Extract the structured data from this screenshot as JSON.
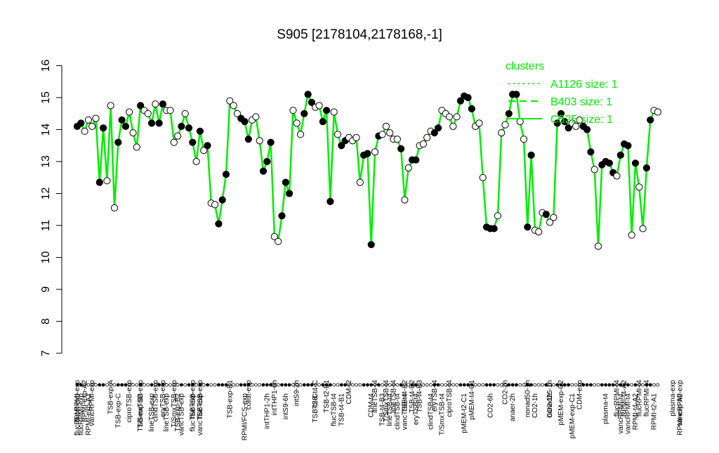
{
  "chart_data": {
    "type": "line",
    "title": "S905 [2178104,2178168,-1]",
    "xlabel": "",
    "ylabel": "",
    "ylim": [
      7,
      16
    ],
    "yticks": [
      7,
      8,
      9,
      10,
      11,
      12,
      13,
      14,
      15,
      16
    ],
    "grid": false,
    "series_color": "#00ee00",
    "y": [
      14.1,
      14.2,
      13.95,
      14.3,
      14.1,
      14.35,
      12.35,
      14.05,
      12.4,
      14.75,
      11.55,
      13.6,
      14.3,
      14.1,
      14.55,
      13.9,
      13.45,
      14.75,
      14.6,
      14.5,
      14.2,
      14.8,
      14.2,
      14.8,
      14.6,
      14.6,
      13.6,
      13.8,
      14.1,
      14.5,
      14.05,
      13.6,
      13.0,
      13.95,
      13.35,
      13.5,
      11.7,
      11.65,
      11.05,
      11.8,
      12.6,
      14.9,
      14.75,
      14.5,
      14.35,
      14.25,
      13.7,
      14.3,
      14.4,
      13.65,
      12.7,
      13.0,
      13.6,
      10.65,
      10.5,
      11.3,
      12.35,
      12.0,
      14.6,
      14.2,
      13.85,
      14.5,
      15.1,
      14.85,
      14.7,
      14.75,
      14.25,
      14.6,
      11.75,
      14.55,
      13.85,
      13.5,
      13.65,
      13.75,
      13.65,
      13.75,
      12.35,
      13.2,
      13.25,
      10.4,
      13.3,
      13.8,
      13.85,
      14.1,
      13.9,
      13.7,
      13.7,
      13.4,
      11.8,
      12.8,
      13.05,
      13.05,
      13.5,
      13.55,
      13.75,
      13.95,
      13.9,
      14.05,
      14.6,
      14.5,
      14.4,
      14.1,
      14.4,
      14.9,
      15.05,
      15.0,
      14.65,
      14.1,
      14.2,
      12.5,
      10.95,
      10.9,
      10.9,
      11.3,
      13.9,
      14.15,
      14.5,
      15.1,
      15.1,
      14.25,
      13.7,
      10.95,
      13.2,
      10.85,
      10.8,
      11.4,
      11.35,
      11.1,
      11.25,
      14.2,
      14.5,
      14.25,
      14.05,
      14.2,
      14.1,
      14.3,
      14.1,
      14.0,
      13.3,
      12.75,
      10.35,
      12.9,
      13.0,
      12.95,
      12.65,
      12.55,
      13.2,
      13.55,
      13.5,
      10.7,
      12.95,
      12.2,
      10.9,
      12.8,
      14.3,
      14.6,
      14.55
    ],
    "filled": [
      1,
      1,
      0,
      0,
      0,
      0,
      1,
      1,
      0,
      0,
      0,
      1,
      1,
      1,
      0,
      0,
      0,
      1,
      0,
      0,
      1,
      0,
      1,
      1,
      0,
      0,
      0,
      0,
      1,
      0,
      1,
      1,
      0,
      1,
      0,
      1,
      0,
      0,
      1,
      1,
      1,
      0,
      0,
      0,
      1,
      1,
      1,
      0,
      0,
      0,
      1,
      1,
      1,
      0,
      0,
      1,
      1,
      1,
      0,
      0,
      0,
      1,
      1,
      1,
      0,
      0,
      1,
      1,
      1,
      0,
      0,
      1,
      1,
      0,
      0,
      0,
      0,
      1,
      1,
      1,
      0,
      1,
      0,
      0,
      0,
      0,
      0,
      1,
      0,
      0,
      1,
      1,
      0,
      0,
      0,
      0,
      1,
      1,
      0,
      0,
      0,
      0,
      0,
      1,
      1,
      1,
      1,
      0,
      0,
      0,
      1,
      1,
      1,
      0,
      0,
      0,
      1,
      1,
      1,
      0,
      0,
      1,
      1,
      0,
      0,
      0,
      1,
      0,
      0,
      1,
      1,
      1,
      1,
      0,
      0,
      0,
      1,
      1,
      1,
      0,
      0,
      1,
      1,
      1,
      1,
      0,
      1,
      1,
      1,
      0,
      1,
      0,
      0,
      1,
      1
    ],
    "tick_labels_upper": [
      "flucRPMI-exp",
      "RPMI-exp-A2",
      "vancRPMI-exp",
      "TSB-exp-A",
      "ciproTSB-exp",
      "T/SmxTSB-exp",
      "clindTSB-exp",
      "eryTSB-exp",
      "T/SmxTSB-exp",
      "flucTSB-exp",
      "flucTSB-exp",
      "TSB-exp-B1",
      "colist-exp",
      "intTHP1-6h",
      "intS9-2h",
      "TSB-t4-C",
      "TSB-t2-B1",
      "CDM-t2",
      "lineTSB-t4",
      "T/SmxTSB-t4",
      "lineTSB-t4",
      "TSB-t4-B2",
      "TSB-t4-B2",
      "TSB-t4-B3",
      "eryTSB-t4",
      "ciproTSB-t4",
      "pMEM-t4-C1",
      "CO2-2h",
      "nonad50-1h",
      "nonad25-1h",
      "pMEM-exp-C2",
      "CDM-exp",
      "flucRPMI-t4",
      "RPMI-t4-A2",
      "flucRPMI-t4",
      "flucRPMI-t4",
      "plasma-exp",
      "vancRPMI-exp"
    ],
    "tick_labels_upper_pos": [
      0,
      2,
      4,
      9,
      14,
      17,
      21,
      23,
      26,
      31,
      33,
      41,
      46,
      53,
      59,
      64,
      67,
      73,
      80,
      83,
      85,
      88,
      90,
      92,
      96,
      100,
      106,
      115,
      121,
      127,
      130,
      135,
      145,
      147,
      151,
      153,
      160,
      162
    ],
    "tick_labels_lower": [
      "flucRPMI-exp",
      "flucRPMI-exp",
      "RPMI-exp-A1",
      "TSB-exp-C",
      "TSB-exp-B3",
      "lineTSB-exp",
      "lineTSB-exp",
      "TSB-exp-B2",
      "vancTSB-exp",
      "flucTSB-exp",
      "vancTSB-exp",
      "RPMI/FCS-exp",
      "intTHP1-2h",
      "intS9-6h",
      "TSB-t2-C",
      "flucTSB-t4",
      "TSB-t4-B1",
      "CDM-t4",
      "TSB-t4-B3",
      "lineTSB-t4",
      "clindTSB-t4",
      "vancTSB-t4",
      "eryTSB-t4",
      "clindTSB-t4",
      "T/SmxTSB-t4",
      "pMEM-t2-C1",
      "CO2-6h",
      "anaer-2h",
      "CO2-1h",
      "CO2-1h",
      "pMEM-exp-C1",
      "plasma-t4",
      "vancRPMI-t4",
      "vancRPMI-t4",
      "RPMI-t4-A2",
      "RPMI-t2-A1",
      "RPMI-exp-A2"
    ],
    "tick_labels_lower_pos": [
      0,
      1,
      3,
      11,
      17,
      20,
      24,
      27,
      28,
      31,
      33,
      45,
      51,
      56,
      64,
      69,
      71,
      79,
      82,
      84,
      86,
      88,
      91,
      95,
      98,
      104,
      111,
      117,
      123,
      127,
      133,
      142,
      146,
      148,
      150,
      155,
      162
    ],
    "legend": {
      "title": "clusters",
      "placement": "top-right",
      "items": [
        {
          "label": "A1126 size: 1",
          "style": "dotted"
        },
        {
          "label": "B403 size: 1",
          "style": "dashed"
        },
        {
          "label": "C525 size: 1",
          "style": "solid"
        }
      ]
    }
  }
}
